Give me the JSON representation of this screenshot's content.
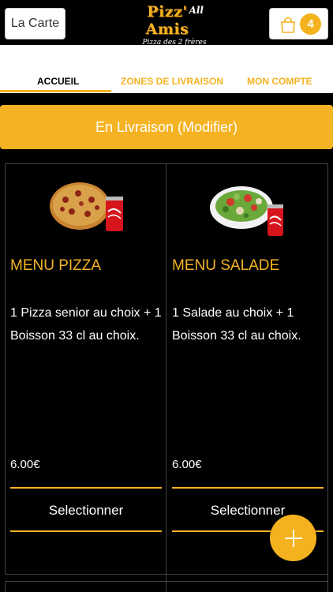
{
  "header": {
    "carte_label": "La Carte",
    "logo_title": "Pizz' Amis",
    "logo_mark": "All",
    "logo_subtitle": "Pizza des 2 frères",
    "cart_count": "4",
    "cart_icon": "shopping-bag-icon"
  },
  "nav": {
    "tabs": [
      {
        "label": "ACCUEIL",
        "active": true
      },
      {
        "label": "ZONES DE LIVRAISON",
        "active": false
      },
      {
        "label": "MON COMPTE",
        "active": false
      }
    ]
  },
  "delivery_button": {
    "label": "En Livraison (Modifier)"
  },
  "menus": [
    {
      "title": "MENU PIZZA",
      "description": "1 Pizza senior au choix + 1 Boisson 33 cl au choix.",
      "price": "6.00€",
      "button_label": "Selectionner",
      "image": "pizza-with-cola-can"
    },
    {
      "title": "MENU SALADE",
      "description": "1 Salade au choix  + 1 Boisson 33 cl au choix.",
      "price": "6.00€",
      "button_label": "Selectionner",
      "image": "salad-with-cola-can"
    }
  ],
  "fab": {
    "icon": "plus-icon"
  },
  "colors": {
    "accent": "#f5b323",
    "background": "#000000",
    "text": "#ffffff"
  }
}
